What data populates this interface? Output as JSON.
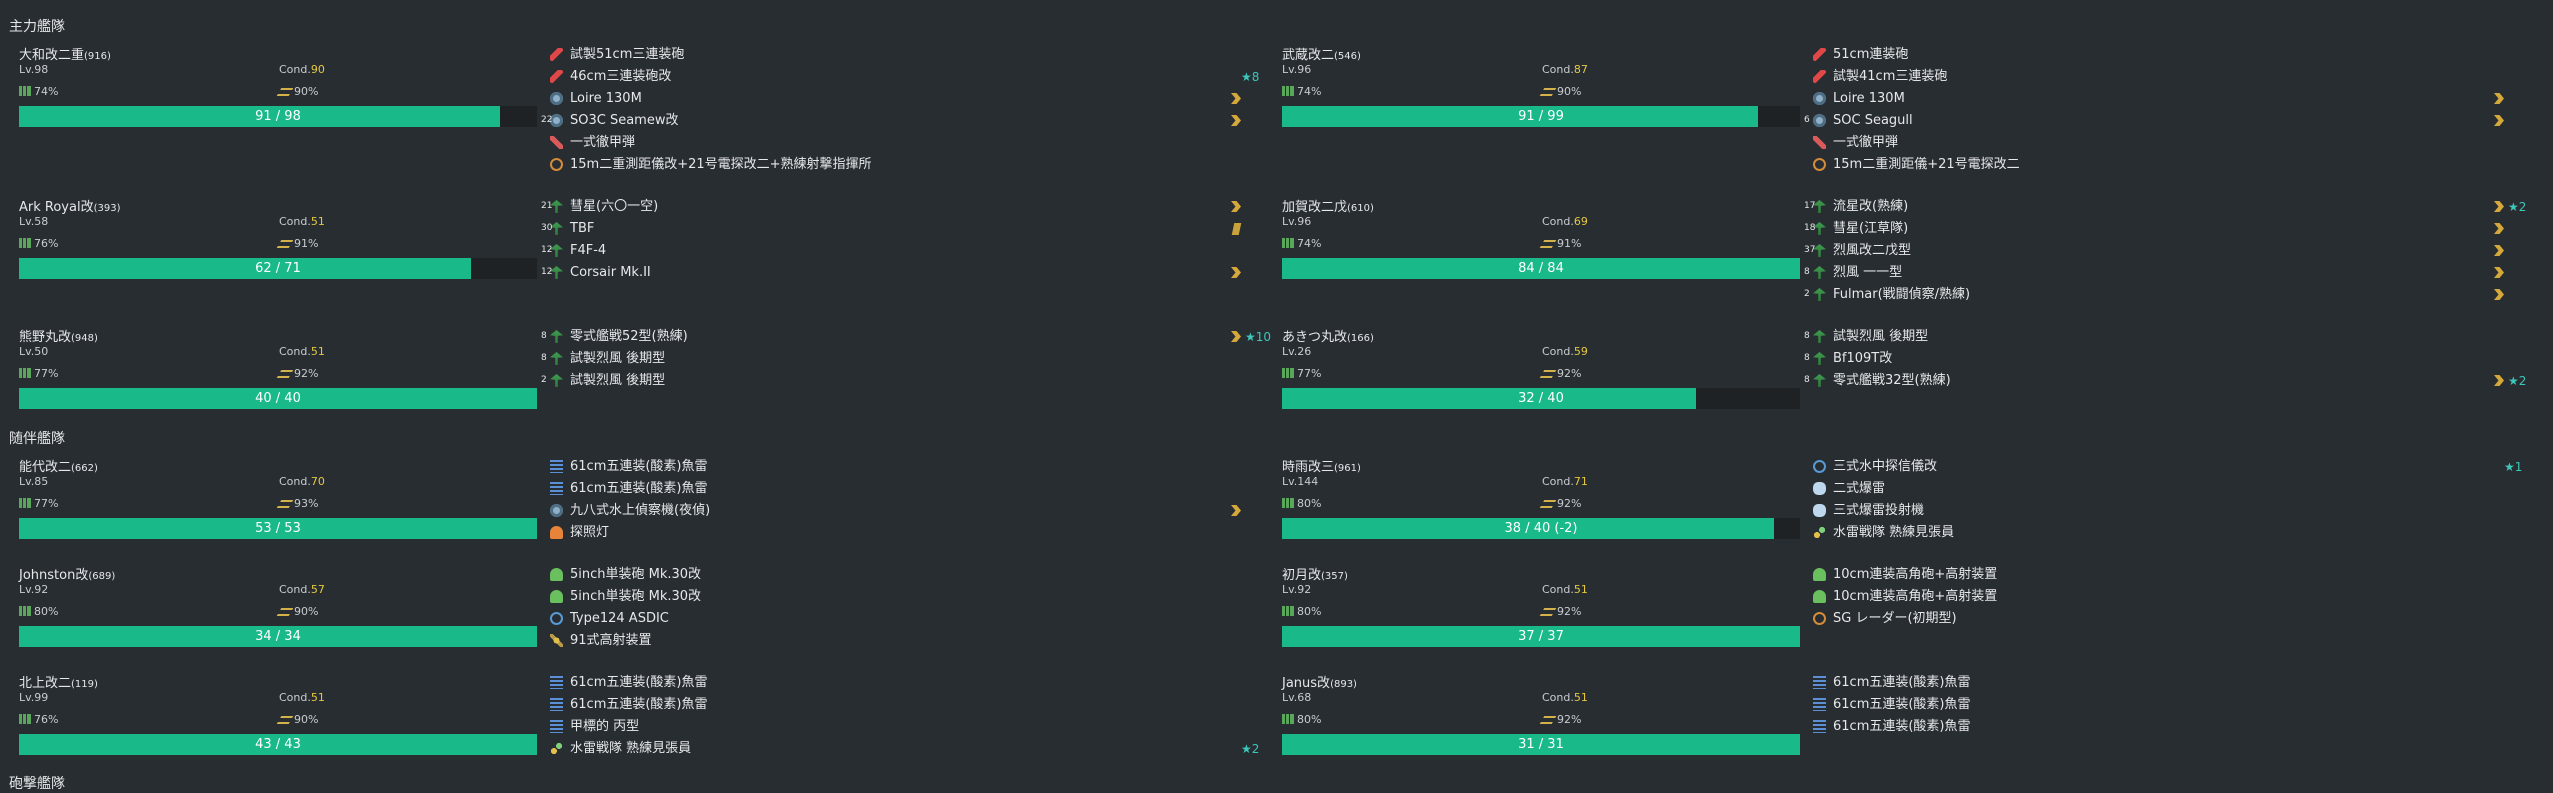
{
  "fleets": [
    {
      "title": "主力艦隊",
      "ships": [
        {
          "name": "大和改二重",
          "id": "(916)",
          "lv": "Lv.98",
          "cond_label": "Cond.",
          "cond": "90",
          "fuel": "74%",
          "ammo": "90%",
          "hp_text": "91 / 98",
          "hp_pct": 92.9,
          "equips": [
            {
              "icon": "gun",
              "name": "試製51cm三連装砲",
              "count": ""
            },
            {
              "icon": "gun",
              "name": "46cm三連装砲改",
              "count": "",
              "improve": "★8"
            },
            {
              "icon": "plane-scout",
              "name": "Loire 130M",
              "count": "",
              "prof": "chevron"
            },
            {
              "icon": "plane-scout",
              "name": "SO3C Seamew改",
              "count": "22",
              "prof": "chevron"
            },
            {
              "icon": "shell",
              "name": "一式徹甲弾",
              "count": ""
            },
            {
              "icon": "radar",
              "name": "15m二重測距儀改+21号電探改二+熟練射撃指揮所",
              "count": ""
            }
          ]
        },
        {
          "name": "武蔵改二",
          "id": "(546)",
          "lv": "Lv.96",
          "cond_label": "Cond.",
          "cond": "87",
          "fuel": "74%",
          "ammo": "90%",
          "hp_text": "91 / 99",
          "hp_pct": 91.9,
          "equips": [
            {
              "icon": "gun",
              "name": "51cm連装砲",
              "count": ""
            },
            {
              "icon": "gun",
              "name": "試製41cm三連装砲",
              "count": ""
            },
            {
              "icon": "plane-scout",
              "name": "Loire 130M",
              "count": "",
              "prof": "chevron"
            },
            {
              "icon": "plane-scout",
              "name": "SOC Seagull",
              "count": "6",
              "prof": "chevron"
            },
            {
              "icon": "shell",
              "name": "一式徹甲弾",
              "count": ""
            },
            {
              "icon": "radar",
              "name": "15m二重測距儀+21号電探改二",
              "count": ""
            }
          ]
        },
        {
          "name": "Ark Royal改",
          "id": "(393)",
          "lv": "Lv.58",
          "cond_label": "Cond.",
          "cond": "51",
          "fuel": "76%",
          "ammo": "91%",
          "hp_text": "62 / 71",
          "hp_pct": 87.3,
          "equips": [
            {
              "icon": "plane-green",
              "name": "彗星(六〇一空)",
              "count": "21",
              "prof": "chevron"
            },
            {
              "icon": "plane-green",
              "name": "TBF",
              "count": "30",
              "prof": "bar"
            },
            {
              "icon": "plane-green",
              "name": "F4F-4",
              "count": "12",
              "prof": ""
            },
            {
              "icon": "plane-green",
              "name": "Corsair Mk.II",
              "count": "12",
              "prof": "chevron"
            }
          ]
        },
        {
          "name": "加賀改二戊",
          "id": "(610)",
          "lv": "Lv.96",
          "cond_label": "Cond.",
          "cond": "69",
          "fuel": "74%",
          "ammo": "91%",
          "hp_text": "84 / 84",
          "hp_pct": 100,
          "equips": [
            {
              "icon": "plane-green",
              "name": "流星改(熟練)",
              "count": "17",
              "prof": "chevron",
              "improve": "★2"
            },
            {
              "icon": "plane-green",
              "name": "彗星(江草隊)",
              "count": "18",
              "prof": "chevron"
            },
            {
              "icon": "plane-green",
              "name": "烈風改二戊型",
              "count": "37",
              "prof": "chevron"
            },
            {
              "icon": "plane-green",
              "name": "烈風 一一型",
              "count": "8",
              "prof": "chevron"
            },
            {
              "icon": "plane-green",
              "name": "Fulmar(戦闘偵察/熟練)",
              "count": "2",
              "prof": "chevron"
            }
          ]
        },
        {
          "name": "熊野丸改",
          "id": "(948)",
          "lv": "Lv.50",
          "cond_label": "Cond.",
          "cond": "51",
          "fuel": "77%",
          "ammo": "92%",
          "hp_text": "40 / 40",
          "hp_pct": 100,
          "equips": [
            {
              "icon": "plane-green",
              "name": "零式艦戦52型(熟練)",
              "count": "8",
              "prof": "chevron",
              "improve": "★10"
            },
            {
              "icon": "plane-green",
              "name": "試製烈風 後期型",
              "count": "8",
              "prof": ""
            },
            {
              "icon": "plane-green",
              "name": "試製烈風 後期型",
              "count": "2",
              "prof": ""
            }
          ]
        },
        {
          "name": "あきつ丸改",
          "id": "(166)",
          "lv": "Lv.26",
          "cond_label": "Cond.",
          "cond": "59",
          "fuel": "77%",
          "ammo": "92%",
          "hp_text": "32 / 40",
          "hp_pct": 80,
          "equips": [
            {
              "icon": "plane-green",
              "name": "試製烈風 後期型",
              "count": "8",
              "prof": ""
            },
            {
              "icon": "plane-green",
              "name": "Bf109T改",
              "count": "8",
              "prof": ""
            },
            {
              "icon": "plane-green",
              "name": "零式艦戦32型(熟練)",
              "count": "8",
              "prof": "chevron",
              "improve": "★2"
            }
          ]
        }
      ]
    },
    {
      "title": "随伴艦隊",
      "ships": [
        {
          "name": "能代改二",
          "id": "(662)",
          "lv": "Lv.85",
          "cond_label": "Cond.",
          "cond": "70",
          "fuel": "77%",
          "ammo": "93%",
          "hp_text": "53 / 53",
          "hp_pct": 100,
          "equips": [
            {
              "icon": "torp",
              "name": "61cm五連装(酸素)魚雷",
              "count": ""
            },
            {
              "icon": "torp",
              "name": "61cm五連装(酸素)魚雷",
              "count": ""
            },
            {
              "icon": "plane-scout",
              "name": "九八式水上偵察機(夜偵)",
              "count": "",
              "prof": "chevron"
            },
            {
              "icon": "light",
              "name": "探照灯",
              "count": ""
            }
          ]
        },
        {
          "name": "時雨改三",
          "id": "(961)",
          "lv": "Lv.144",
          "cond_label": "Cond.",
          "cond": "71",
          "fuel": "80%",
          "ammo": "92%",
          "hp_text": "38 / 40 (-2)",
          "hp_pct": 95,
          "equips": [
            {
              "icon": "sonar",
              "name": "三式水中探信儀改",
              "count": "",
              "improve": "★1"
            },
            {
              "icon": "depth",
              "name": "二式爆雷",
              "count": ""
            },
            {
              "icon": "depth",
              "name": "三式爆雷投射機",
              "count": ""
            },
            {
              "icon": "lookout",
              "name": "水雷戦隊 熟練見張員",
              "count": ""
            }
          ]
        },
        {
          "name": "Johnston改",
          "id": "(689)",
          "lv": "Lv.92",
          "cond_label": "Cond.",
          "cond": "57",
          "fuel": "80%",
          "ammo": "90%",
          "hp_text": "34 / 34",
          "hp_pct": 100,
          "equips": [
            {
              "icon": "aa",
              "name": "5inch単装砲 Mk.30改",
              "count": ""
            },
            {
              "icon": "aa",
              "name": "5inch単装砲 Mk.30改",
              "count": ""
            },
            {
              "icon": "sonar",
              "name": "Type124 ASDIC",
              "count": ""
            },
            {
              "icon": "aafd",
              "name": "91式高射装置",
              "count": ""
            }
          ]
        },
        {
          "name": "初月改",
          "id": "(357)",
          "lv": "Lv.92",
          "cond_label": "Cond.",
          "cond": "51",
          "fuel": "80%",
          "ammo": "92%",
          "hp_text": "37 / 37",
          "hp_pct": 100,
          "equips": [
            {
              "icon": "aa",
              "name": "10cm連装高角砲+高射装置",
              "count": ""
            },
            {
              "icon": "aa",
              "name": "10cm連装高角砲+高射装置",
              "count": ""
            },
            {
              "icon": "radar",
              "name": "SG レーダー(初期型)",
              "count": ""
            }
          ]
        },
        {
          "name": "北上改二",
          "id": "(119)",
          "lv": "Lv.99",
          "cond_label": "Cond.",
          "cond": "51",
          "fuel": "76%",
          "ammo": "90%",
          "hp_text": "43 / 43",
          "hp_pct": 100,
          "equips": [
            {
              "icon": "torp",
              "name": "61cm五連装(酸素)魚雷",
              "count": ""
            },
            {
              "icon": "torp",
              "name": "61cm五連装(酸素)魚雷",
              "count": ""
            },
            {
              "icon": "torp",
              "name": "甲標的 丙型",
              "count": ""
            },
            {
              "icon": "lookout",
              "name": "水雷戦隊 熟練見張員",
              "count": "",
              "improve": "★2"
            }
          ]
        },
        {
          "name": "Janus改",
          "id": "(893)",
          "lv": "Lv.68",
          "cond_label": "Cond.",
          "cond": "51",
          "fuel": "80%",
          "ammo": "92%",
          "hp_text": "31 / 31",
          "hp_pct": 100,
          "equips": [
            {
              "icon": "torp",
              "name": "61cm五連装(酸素)魚雷",
              "count": ""
            },
            {
              "icon": "torp",
              "name": "61cm五連装(酸素)魚雷",
              "count": ""
            },
            {
              "icon": "torp",
              "name": "61cm五連装(酸素)魚雷",
              "count": ""
            }
          ]
        }
      ]
    },
    {
      "title": "砲撃艦隊",
      "ships": []
    }
  ]
}
